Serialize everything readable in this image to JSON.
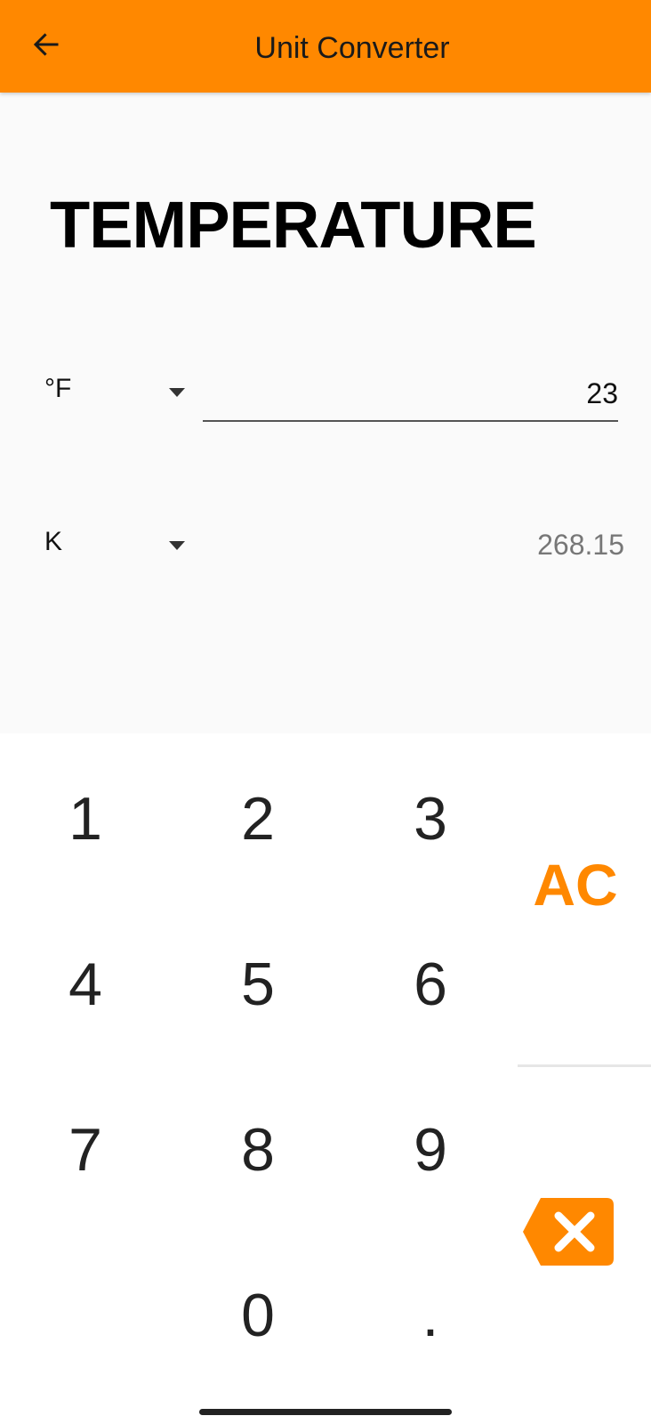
{
  "app_bar": {
    "title": "Unit Converter",
    "back_icon": "arrow-left-icon",
    "color": "#FF8800"
  },
  "converter": {
    "category": "TEMPERATURE",
    "from": {
      "unit": "°F",
      "value": "23"
    },
    "to": {
      "unit": "K",
      "value": "268.15"
    }
  },
  "keypad": {
    "keys": [
      "1",
      "2",
      "3",
      "4",
      "5",
      "6",
      "7",
      "8",
      "9",
      "0",
      "."
    ],
    "clear_label": "AC",
    "backspace_icon": "backspace-icon",
    "accent_color": "#FF8800"
  }
}
